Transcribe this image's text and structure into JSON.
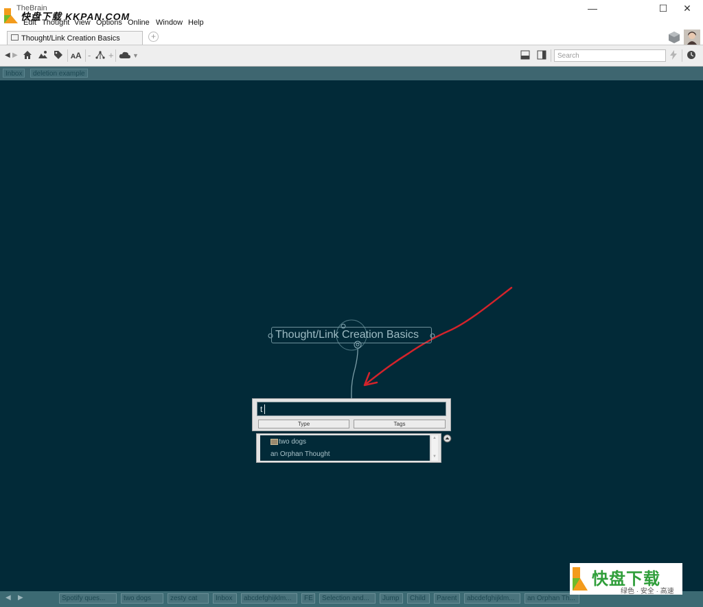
{
  "window": {
    "title": "TheBrain",
    "watermark": "快盘下载  KKPAN.COM"
  },
  "menu": [
    "Edit",
    "Thought",
    "View",
    "Options",
    "Online",
    "Window",
    "Help"
  ],
  "tab": {
    "label": "Thought/Link Creation Basics"
  },
  "search": {
    "placeholder": "Search"
  },
  "pins": [
    "Inbox",
    "deletion example"
  ],
  "plex": {
    "active_thought": "Thought/Link Creation Basics",
    "new_thought_input": "t",
    "buttons": {
      "type": "Type",
      "tags": "Tags"
    },
    "suggestions": [
      "two dogs",
      "an Orphan Thought"
    ]
  },
  "status_bar": [
    "Spotify ques...",
    "two dogs",
    "zesty cat",
    "Inbox",
    "abcdefghijklm...",
    "FE",
    "Selection and...",
    "Jump",
    "Child",
    "Parent",
    "abcdefghijklm...",
    "an Orphan Th..."
  ],
  "logo_badge": {
    "title": "快盘下载",
    "subtitle": "绿色 · 安全 · 高速"
  },
  "colors": {
    "plex_bg": "#022a38",
    "arrow": "#d4232b",
    "pins_bg": "#3e6670"
  }
}
